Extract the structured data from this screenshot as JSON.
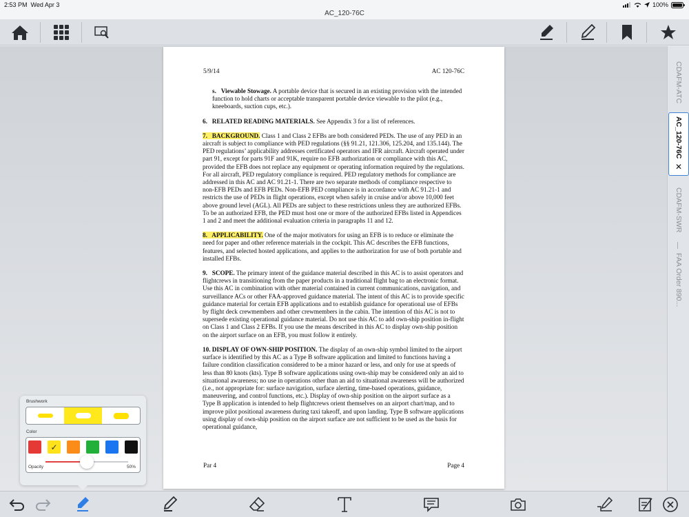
{
  "status": {
    "time": "2:53 PM",
    "date": "Wed Apr 3",
    "battery": "100%"
  },
  "window": {
    "title": "AC_120-76C"
  },
  "toolbar": {
    "icons": [
      "home-icon",
      "grid-icon",
      "search-icon",
      "highlighter-icon",
      "pen-icon",
      "bookmark-icon",
      "star-icon"
    ]
  },
  "page": {
    "header_left": "5/9/14",
    "header_right": "AC 120-76C",
    "para_s_num": "s.",
    "para_s_title": "Viewable Stowage.",
    "para_s_text": "A portable device that is secured in an existing provision with the intended function to hold charts or acceptable transparent portable device viewable to the pilot (e.g., kneeboards, suction cups, etc.).",
    "para6_num": "6.",
    "para6_title": "RELATED READING MATERIALS.",
    "para6_text": "See Appendix 3 for a list of references.",
    "para7_num": "7.",
    "para7_title": "BACKGROUND.",
    "para7_text": "Class 1 and Class 2 EFBs are both considered PEDs. The use of any PED in an aircraft is subject to compliance with PED regulations (§§ 91.21, 121.306, 125.204, and 135.144). The PED regulations’ applicability addresses certificated operators and IFR aircraft. Aircraft operated under part 91, except for parts 91F and 91K, require no EFB authorization or compliance with this AC, provided the EFB does not replace any equipment or operating information required by the regulations. For all aircraft, PED regulatory compliance is required. PED regulatory methods for compliance are addressed in this AC and AC 91.21-1. There are two separate methods of compliance respective to non-EFB PEDs and EFB PEDs. Non-EFB PED compliance is in accordance with AC 91.21-1 and restricts the use of PEDs in flight operations, except when safely in cruise and/or above 10,000 feet above ground level (AGL). All PEDs are subject to these restrictions unless they are authorized EFBs. To be an authorized EFB, the PED must host one or more of the authorized EFBs listed in Appendices 1 and 2 and meet the additional evaluation criteria in paragraphs 11 and 12.",
    "para8_num": "8.",
    "para8_title": "APPLICABILITY.",
    "para8_text": "One of the major motivators for using an EFB is to reduce or eliminate the need for paper and other reference materials in the cockpit. This AC describes the EFB functions, features, and selected hosted applications, and applies to the authorization for use of both portable and installed EFBs.",
    "para9_num": "9.",
    "para9_title": "SCOPE.",
    "para9_text": "The primary intent of the guidance material described in this AC is to assist operators and flightcrews in transitioning from the paper products in a traditional flight bag to an electronic format. Use this AC in combination with other material contained in current communications, navigation, and surveillance ACs or other FAA-approved guidance material. The intent of this AC is to provide specific guidance material for certain EFB applications and to establish guidance for operational use of EFBs by flight deck crewmembers and other crewmembers in the cabin. The intention of this AC is not to supersede existing operational guidance material. Do not use this AC to add own-ship position in-flight on Class 1 and Class 2 EFBs. If you use the means described in this AC to display own-ship position on the airport surface on an EFB, you must follow it entirely.",
    "para10_num": "10.",
    "para10_title": "DISPLAY OF OWN-SHIP POSITION.",
    "para10_text": "The display of an own-ship symbol limited to the airport surface is identified by this AC as a Type B software application and limited to functions having a failure condition classification considered to be a minor hazard or less, and only for use at speeds of less than 80 knots (kts). Type B software applications using own-ship may be considered only an aid to situational awareness; no use in operations other than an aid to situational awareness will be authorized (i.e., not appropriate for: surface navigation, surface alerting, time-based operations, guidance, maneuvering, and control functions, etc.). Display of own-ship position on the airport surface as a Type B application is intended to help flightcrews orient themselves on an airport chart/map, and to improve pilot positional awareness during taxi takeoff, and upon landing. Type B software applications using display of own-ship position on the airport surface are not sufficient to be used as the basis for operational guidance,",
    "footer_left": "Par 4",
    "footer_right": "Page 4"
  },
  "sidetabs": [
    {
      "label": "CDAFM-ATC",
      "active": false
    },
    {
      "label": "AC_120-76C",
      "active": true,
      "close": "✕"
    },
    {
      "label": "CDAFM-SWR",
      "active": false
    },
    {
      "label": "FAA Order 890...",
      "active": false
    }
  ],
  "brushwork": {
    "title": "Brushwork",
    "sizes": [
      "thin",
      "medium",
      "thick"
    ],
    "selected_size": 1,
    "color_label": "Color",
    "colors": [
      "#e53935",
      "#ffe21a",
      "#fb8c1a",
      "#22b03a",
      "#1976f0",
      "#111111"
    ],
    "selected_color": 1,
    "check": "✓",
    "opacity_label": "Opacity",
    "opacity_value": "50%",
    "opacity": 0.5
  },
  "bottom_toolbar": {
    "icons": [
      "undo-icon",
      "redo-icon",
      "highlighter-icon",
      "pen-icon",
      "eraser-icon",
      "text-icon",
      "note-icon",
      "camera-icon",
      "signature-icon",
      "form-icon",
      "close-icon"
    ]
  }
}
